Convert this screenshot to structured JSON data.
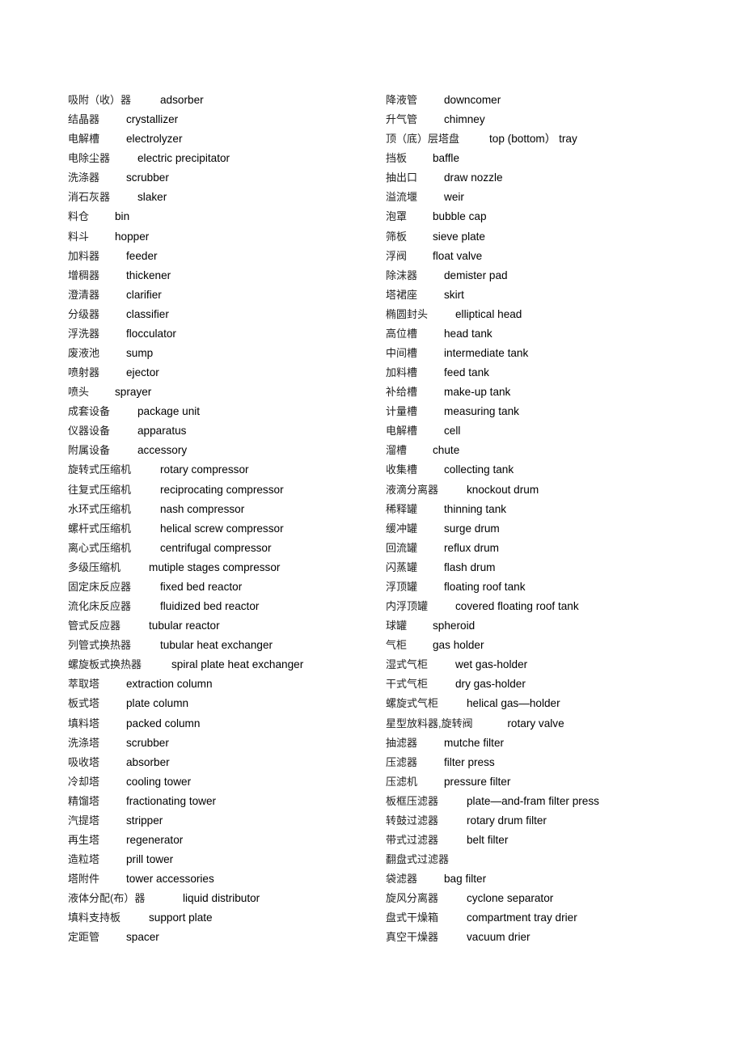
{
  "left": [
    {
      "cn": "吸附（收）器",
      "en": "adsorber"
    },
    {
      "cn": "结晶器",
      "en": "crystallizer"
    },
    {
      "cn": "电解槽",
      "en": "electrolyzer"
    },
    {
      "cn": "电除尘器",
      "en": "electric precipitator"
    },
    {
      "cn": "洗涤器",
      "en": "scrubber"
    },
    {
      "cn": "消石灰器",
      "en": "slaker"
    },
    {
      "cn": "料仓",
      "en": "bin"
    },
    {
      "cn": "料斗",
      "en": "hopper"
    },
    {
      "cn": "加料器",
      "en": "feeder"
    },
    {
      "cn": "增稠器",
      "en": "thickener"
    },
    {
      "cn": "澄清器",
      "en": "clarifier"
    },
    {
      "cn": "分级器",
      "en": "classifier"
    },
    {
      "cn": "浮洗器",
      "en": "flocculator"
    },
    {
      "cn": "废液池",
      "en": "sump"
    },
    {
      "cn": "喷射器",
      "en": "ejector"
    },
    {
      "cn": "喷头",
      "en": "sprayer"
    },
    {
      "cn": "成套设备",
      "en": "package unit"
    },
    {
      "cn": "仪器设备",
      "en": "apparatus"
    },
    {
      "cn": "附属设备",
      "en": "accessory"
    },
    {
      "cn": "旋转式压缩机",
      "en": "rotary compressor"
    },
    {
      "cn": "往复式压缩机",
      "en": "reciprocating compressor"
    },
    {
      "cn": "水环式压缩机",
      "en": "nash compressor"
    },
    {
      "cn": "螺杆式压缩机",
      "en": "helical screw compressor"
    },
    {
      "cn": "离心式压缩机",
      "en": "centrifugal compressor"
    },
    {
      "cn": "多级压缩机",
      "en": "mutiple stages compressor"
    },
    {
      "cn": "固定床反应器",
      "en": "fixed bed reactor"
    },
    {
      "cn": "流化床反应器",
      "en": "fluidized bed reactor"
    },
    {
      "cn": "管式反应器",
      "en": "tubular reactor"
    },
    {
      "cn": "列管式换热器",
      "en": "tubular heat exchanger"
    },
    {
      "cn": "螺旋板式换热器",
      "en": "spiral plate heat exchanger"
    },
    {
      "cn": "萃取塔",
      "en": "extraction column"
    },
    {
      "cn": "板式塔",
      "en": "plate column"
    },
    {
      "cn": "填料塔",
      "en": "packed column"
    },
    {
      "cn": "洗涤塔",
      "en": "scrubber"
    },
    {
      "cn": "吸收塔",
      "en": "absorber"
    },
    {
      "cn": "冷却塔",
      "en": "cooling tower"
    },
    {
      "cn": "精馏塔",
      "en": "fractionating tower"
    },
    {
      "cn": "汽提塔",
      "en": "stripper"
    },
    {
      "cn": "再生塔",
      "en": "regenerator"
    },
    {
      "cn": "造粒塔",
      "en": "prill tower"
    },
    {
      "cn": "塔附件",
      "en": "tower accessories"
    },
    {
      "cn": "液体分配(布）器",
      "en": "liquid distributor"
    },
    {
      "cn": "填料支持板",
      "en": "support plate"
    },
    {
      "cn": "定距管",
      "en": "spacer"
    }
  ],
  "right": [
    {
      "cn": "降液管",
      "en": "downcomer"
    },
    {
      "cn": "升气管",
      "en": "chimney"
    },
    {
      "cn": "顶（底）层塔盘",
      "en": "top (bottom）  tray"
    },
    {
      "cn": "挡板",
      "en": "baffle"
    },
    {
      "cn": "抽出口",
      "en": "draw nozzle"
    },
    {
      "cn": "溢流堰",
      "en": "weir"
    },
    {
      "cn": "泡罩",
      "en": "bubble cap"
    },
    {
      "cn": "筛板",
      "en": "sieve plate"
    },
    {
      "cn": "浮阀",
      "en": "float valve"
    },
    {
      "cn": "除沫器",
      "en": "demister pad"
    },
    {
      "cn": "塔裙座",
      "en": "skirt"
    },
    {
      "cn": "椭圆封头",
      "en": "elliptical head"
    },
    {
      "cn": "高位槽",
      "en": "head tank"
    },
    {
      "cn": "中间槽",
      "en": "intermediate tank"
    },
    {
      "cn": "加料槽",
      "en": "feed tank"
    },
    {
      "cn": "补给槽",
      "en": "make-up tank"
    },
    {
      "cn": "计量槽",
      "en": "measuring tank"
    },
    {
      "cn": "电解槽",
      "en": "cell"
    },
    {
      "cn": "溜槽",
      "en": "chute"
    },
    {
      "cn": "收集槽",
      "en": "collecting tank"
    },
    {
      "cn": "液滴分离器",
      "en": "knockout drum"
    },
    {
      "cn": "稀释罐",
      "en": "thinning tank"
    },
    {
      "cn": "缓冲罐",
      "en": "surge drum"
    },
    {
      "cn": "回流罐",
      "en": "reflux drum"
    },
    {
      "cn": "闪蒸罐",
      "en": "flash drum"
    },
    {
      "cn": "浮顶罐",
      "en": "floating roof tank"
    },
    {
      "cn": "内浮顶罐",
      "en": "covered floating roof tank"
    },
    {
      "cn": "球罐",
      "en": "spheroid"
    },
    {
      "cn": "气柜",
      "en": "gas holder"
    },
    {
      "cn": "湿式气柜",
      "en": "wet gas-holder"
    },
    {
      "cn": "干式气柜",
      "en": "dry gas-holder"
    },
    {
      "cn": "螺旋式气柜",
      "en": "helical gas—holder"
    },
    {
      "cn": "星型放料器,旋转阀",
      "en": "rotary valve"
    },
    {
      "cn": "抽滤器",
      "en": "mutche filter"
    },
    {
      "cn": "压滤器",
      "en": "filter press"
    },
    {
      "cn": "压滤机",
      "en": "pressure filter"
    },
    {
      "cn": "板框压滤器",
      "en": "plate—and-fram filter press"
    },
    {
      "cn": "转鼓过滤器",
      "en": "rotary drum filter"
    },
    {
      "cn": "带式过滤器",
      "en": "belt filter"
    },
    {
      "cn": "翻盘式过滤器",
      "en": ""
    },
    {
      "cn": "袋滤器",
      "en": "bag filter"
    },
    {
      "cn": "旋风分离器",
      "en": "cyclone separator"
    },
    {
      "cn": "盘式干燥箱",
      "en": "compartment tray drier"
    },
    {
      "cn": "真空干燥器",
      "en": "vacuum drier"
    }
  ]
}
